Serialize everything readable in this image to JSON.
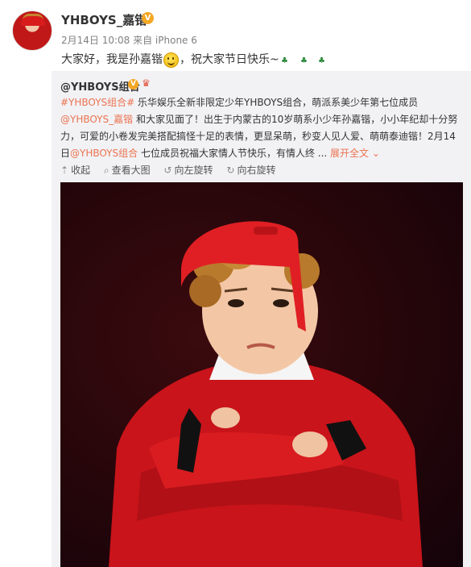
{
  "post": {
    "username": "YHBOYS_嘉锴",
    "verified_badge": "V",
    "meta": "2月14日 10:08 来自 iPhone 6",
    "text_before_emoji": "大家好，我是孙嘉锴",
    "text_after_emoji": "，祝大家节日快乐~",
    "emoji_icon": "smiley-face-icon"
  },
  "repost": {
    "author": "@YHBOYS组合",
    "verified_badge": "V",
    "line1_link": "#YHBOYS组合#",
    "line1_text": " 乐华娱乐全新非限定少年YHBOYS组合，萌派系美少年第七位成员",
    "line2_link": "@YHBOYS_嘉锴",
    "line2_text": " 和大家见面了！出生于内蒙古的10岁萌系小少年孙嘉锴，小小年纪却十分努",
    "line3_text": "力，可爱的小卷发完美搭配搞怪十足的表情，更显呆萌，秒变人见人爱、萌萌泰迪锴！2月14",
    "line4_prefix": "日",
    "line4_link": "@YHBOYS组合",
    "line4_text": " 七位成员祝福大家情人节快乐，有情人终 ... ",
    "expand_label": "展开全文 ⌄"
  },
  "toolbar": {
    "collapse": "收起",
    "view_large": "查看大图",
    "rotate_left": "向左旋转",
    "rotate_right": "向右旋转"
  },
  "colors": {
    "link": "#eb7350",
    "repost_bg": "#f2f2f5",
    "badge": "#f5a623"
  }
}
